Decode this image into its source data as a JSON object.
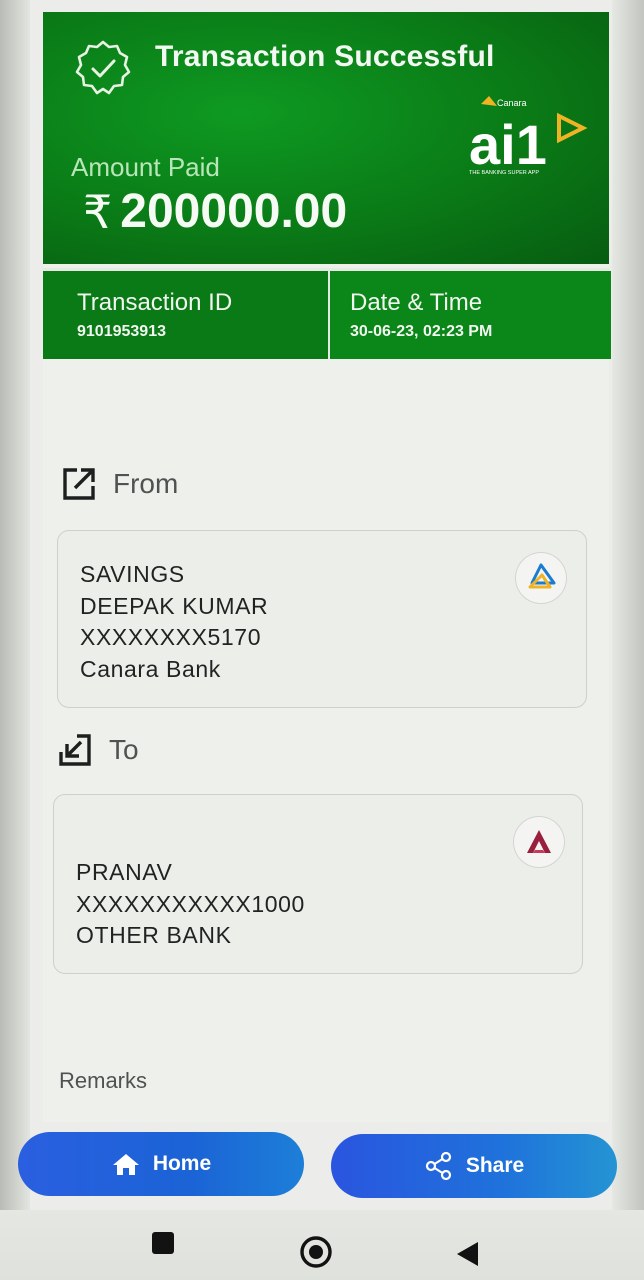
{
  "header": {
    "title": "Transaction Successful",
    "amount_label": "Amount Paid",
    "currency_symbol": "₹",
    "amount": "200000.00",
    "logo": {
      "brand_small": "Canara",
      "brand_big": "ai1",
      "tagline": "THE BANKING SUPER APP"
    }
  },
  "transaction": {
    "id_label": "Transaction ID",
    "id_value": "9101953913",
    "datetime_label": "Date & Time",
    "datetime_value": "30-06-23, 02:23 PM"
  },
  "from": {
    "label": "From",
    "icon": "external-link-icon",
    "lines": [
      "SAVINGS",
      "DEEPAK KUMAR",
      "XXXXXXXX5170",
      "Canara Bank"
    ],
    "bank_icon": "canara-bank-icon"
  },
  "to": {
    "label": "To",
    "icon": "arrow-down-left-icon",
    "lines": [
      "PRANAV",
      "XXXXXXXXXXX1000",
      "OTHER BANK"
    ],
    "bank_icon": "axis-bank-icon"
  },
  "remarks": {
    "label": "Remarks"
  },
  "actions": {
    "home_label": "Home",
    "share_label": "Share"
  },
  "colors": {
    "header_green": "#0a7a16",
    "button_blue": "#1f63d8",
    "canara_yellow": "#f0b323",
    "canara_blue": "#1a7bd2",
    "axis_red": "#9a1e3d"
  }
}
